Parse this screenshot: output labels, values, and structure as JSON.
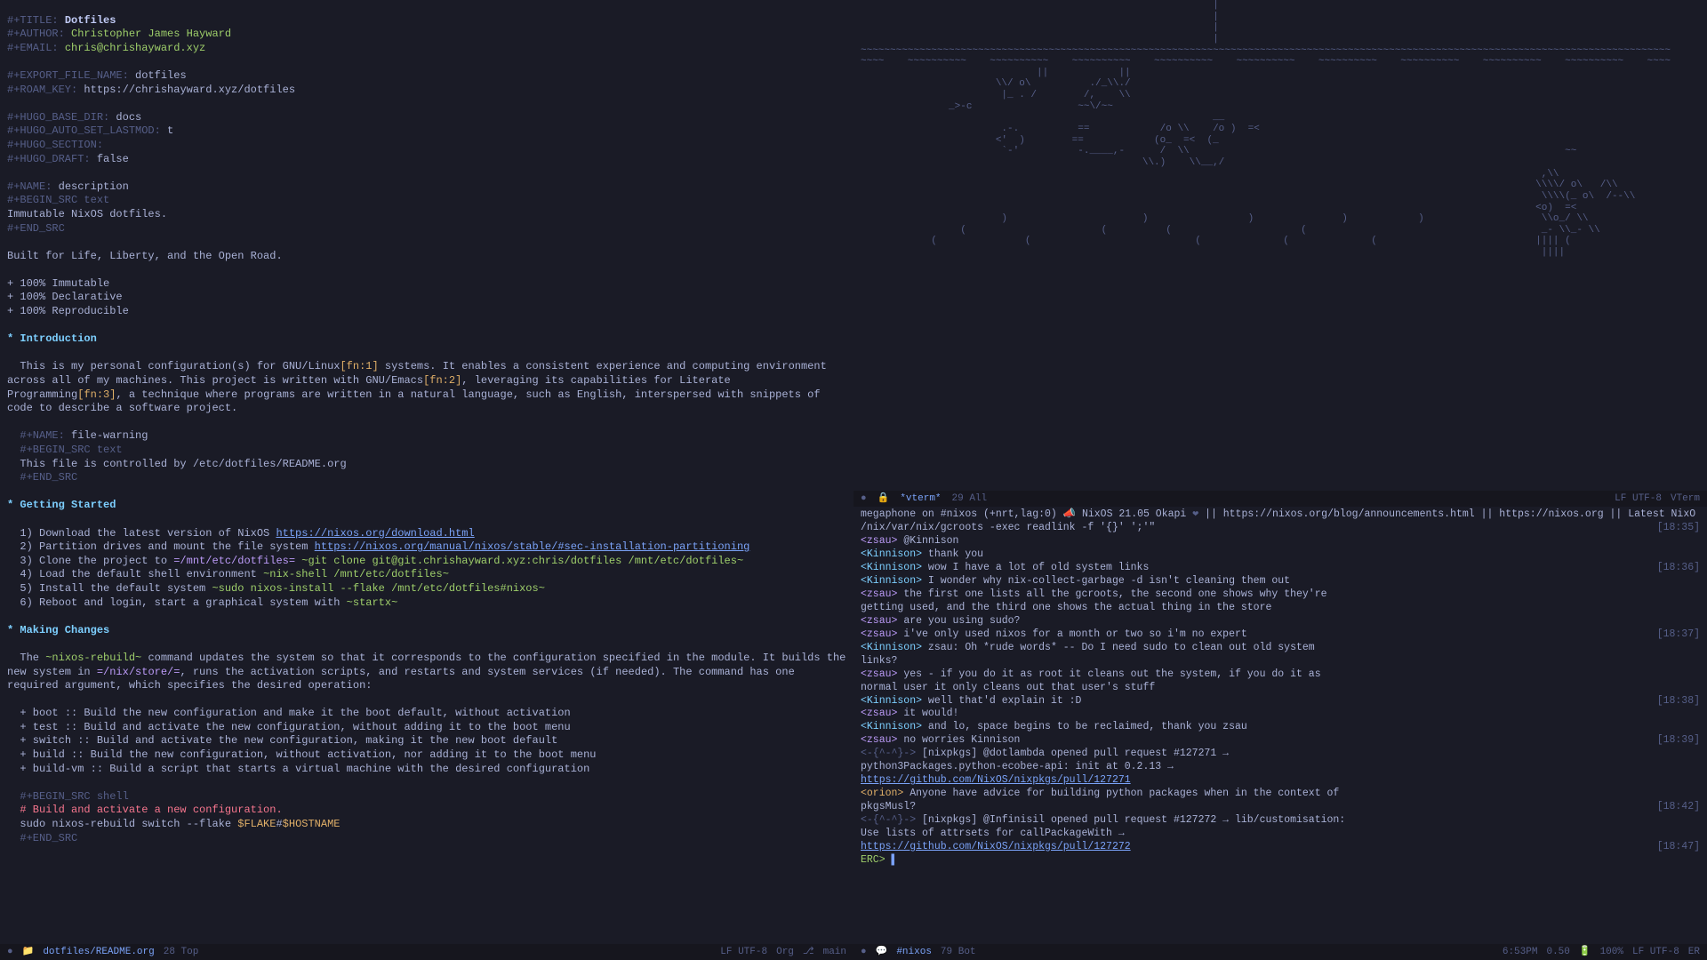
{
  "doc": {
    "title_kw": "#+TITLE:",
    "title": "Dotfiles",
    "author_kw": "#+AUTHOR:",
    "author": "Christopher James Hayward",
    "email_kw": "#+EMAIL:",
    "email": "chris@chrishayward.xyz",
    "export_kw": "#+EXPORT_FILE_NAME:",
    "export": "dotfiles",
    "roam_kw": "#+ROAM_KEY:",
    "roam": "https://chrishayward.xyz/dotfiles",
    "hugo_base_kw": "#+HUGO_BASE_DIR:",
    "hugo_base": "docs",
    "hugo_lastmod_kw": "#+HUGO_AUTO_SET_LASTMOD:",
    "hugo_lastmod": "t",
    "hugo_section_kw": "#+HUGO_SECTION:",
    "hugo_draft_kw": "#+HUGO_DRAFT:",
    "hugo_draft": "false",
    "name_desc_kw": "#+NAME:",
    "name_desc": "description",
    "begin_src_text": "#+BEGIN_SRC text",
    "desc_body": "Immutable NixOS dotfiles.",
    "end_src": "#+END_SRC",
    "tagline": "Built for Life, Liberty, and the Open Road.",
    "bullets": [
      "+ 100% Immutable",
      "+ 100% Declarative",
      "+ 100% Reproducible"
    ],
    "h_intro": "* Introduction",
    "intro_p1a": "This is my personal configuration(s) for GNU/Linux",
    "fn1": "[fn:1]",
    "intro_p1b": " systems. It enables a consistent experience and computing environment across all of my machines. This project is written with GNU/Emacs",
    "fn2": "[fn:2]",
    "intro_p1c": ", leveraging its capabilities for Literate Programming",
    "fn3": "[fn:3]",
    "intro_p1d": ", a technique where programs are written in a natural language, such as English, interspersed with snippets of code to describe a software project.",
    "name_warn": "file-warning",
    "warn_body": "This file is controlled by /etc/dotfiles/README.org",
    "h_getting": "* Getting Started",
    "step1a": "1) Download the latest version of NixOS ",
    "step1_link": "https://nixos.org/download.html",
    "step2a": "2) Partition drives and mount the file system ",
    "step2_link": "https://nixos.org/manual/nixos/stable/#sec-installation-partitioning",
    "step3a": "3) Clone the project to ",
    "step3_path": "=/mnt/etc/dotfiles=",
    "step3_cmd": " ~git clone git@git.chrishayward.xyz:chris/dotfiles /mnt/etc/dotfiles~",
    "step4a": "4) Load the default shell environment ",
    "step4_cmd": "~nix-shell /mnt/etc/dotfiles~",
    "step5a": "5) Install the default system ",
    "step5_cmd": "~sudo nixos-install --flake /mnt/etc/dotfiles#nixos~",
    "step6a": "6) Reboot and login, start a graphical system with ",
    "step6_cmd": "~startx~",
    "h_making": "* Making Changes",
    "mc_p1a": "The ",
    "mc_cmd1": "~nixos-rebuild~",
    "mc_p1b": " command updates the system so that it corresponds to the configuration specified in the module. It builds the new system in ",
    "mc_path": "=/nix/store/=",
    "mc_p1c": ", runs the activation scripts, and restarts and system services (if needed). The command has one required argument, which specifies the desired operation:",
    "ops": [
      "+ boot :: Build the new configuration and make it the boot default, without activation",
      "+ test :: Build and activate the new configuration, without adding it to the boot menu",
      "+ switch :: Build and activate the new configuration, making it the new boot default",
      "+ build :: Build the new configuration, without activation, nor adding it to the boot menu",
      "+ build-vm :: Build a script that starts a virtual machine with the desired configuration"
    ],
    "begin_shell": "#+BEGIN_SRC shell",
    "shell_comment": "# Build and activate a new configuration.",
    "shell_cmd_a": "sudo nixos-rebuild switch --flake ",
    "shell_var1": "$FLAKE",
    "shell_hash": "#",
    "shell_var2": "$HOSTNAME"
  },
  "vterm": {
    "art": "                                                            |\n                                                            |\n                                                            |\n                                                            |\n~~~~~~~~~~~~~~~~~~~~~~~~~~~~~~~~~~~~~~~~~~~~~~~~~~~~~~~~~~~~~~~~~~~~~~~~~~~~~~~~~~~~~~~~~~~~~~~~~~~~~~~~~~~~~~~~~~~~~~~~~~~~~~~~~~~~~~~~~~\n~~~~    ~~~~~~~~~~    ~~~~~~~~~~    ~~~~~~~~~~    ~~~~~~~~~~    ~~~~~~~~~~    ~~~~~~~~~~    ~~~~~~~~~~    ~~~~~~~~~~    ~~~~~~~~~~    ~~~~\n                              ||            ||\n                       \\\\/ o\\          ./_\\\\./\n                        |_ . /        /,    \\\\\n               _>-c                  ~~\\/~~\n                                                            __\n                        .-.          ==            /o \\\\    /o )  =<\n                       <'  )        ==            (o_  =<  (_\n                        `-'          -.____,-      /  \\\\                                                                ~~\n                                                \\\\.)    \\\\__,/\n                                                                                                                    ,\\\\\n                                                                                                                   \\\\\\\\/ o\\   /\\\\\n                                                                                                                    \\\\\\\\(_ o\\  /--\\\\\n                                                                                                                   <o)  =<\n                        )                       )                 )               )            )                    \\\\o_/ \\\\\n                 (                       (          (                      (                                        _- \\\\_- \\\\\n            (               (                            (              (              (                           |||| (\n                                                                                                                    ||||\n",
    "modeline": {
      "buffer": "*vterm*",
      "pos": "29 All",
      "enc": "LF UTF-8",
      "mode": "VTerm"
    }
  },
  "irc": {
    "topic_a": "megaphone on #nixos (+nrt,lag:0) ",
    "topic_b": " NixOS 21.05 Okapi ",
    "topic_c": " || https://nixos.org/blog/announcements.html || https://nixos.org || Latest NixO",
    "topic2": "                /nix/var/nix/gcroots -exec readlink -f '{}' ';'\"",
    "lines": [
      {
        "nick": "zsau",
        "cls": "nick",
        "text": " @Kinnison",
        "ts": ""
      },
      {
        "nick": "Kinnison",
        "cls": "nick2",
        "text": " thank you",
        "ts": ""
      },
      {
        "nick": "Kinnison",
        "cls": "nick2",
        "text": " wow I have a lot of old system links",
        "ts": "[18:36]"
      },
      {
        "nick": "Kinnison",
        "cls": "nick2",
        "text": " I wonder why nix-collect-garbage -d isn't cleaning them out",
        "ts": ""
      },
      {
        "nick": "zsau",
        "cls": "nick",
        "text": " the first one lists all the gcroots, the second one shows why they're",
        "ts": ""
      },
      {
        "nick": "",
        "cls": "",
        "text": "        getting used, and the third one shows the actual thing in the store",
        "ts": ""
      },
      {
        "nick": "zsau",
        "cls": "nick",
        "text": " are you using sudo?",
        "ts": ""
      },
      {
        "nick": "zsau",
        "cls": "nick",
        "text": " i've only used nixos for a month or two so i'm no expert",
        "ts": "[18:37]"
      },
      {
        "nick": "Kinnison",
        "cls": "nick2",
        "text": " zsau: Oh *rude words* -- Do I need sudo to clean out old system",
        "ts": ""
      },
      {
        "nick": "",
        "cls": "",
        "text": "           links?",
        "ts": ""
      },
      {
        "nick": "zsau",
        "cls": "nick",
        "text": " yes - if you do it as root it cleans out the system, if you do it as",
        "ts": ""
      },
      {
        "nick": "",
        "cls": "",
        "text": "        normal user it only cleans out that user's stuff",
        "ts": ""
      },
      {
        "nick": "Kinnison",
        "cls": "nick2",
        "text": " well that'd explain it :D",
        "ts": "[18:38]"
      },
      {
        "nick": "zsau",
        "cls": "nick",
        "text": " it would!",
        "ts": ""
      },
      {
        "nick": "Kinnison",
        "cls": "nick2",
        "text": " and lo, space begins to be reclaimed, thank you zsau",
        "ts": ""
      },
      {
        "nick": "zsau",
        "cls": "nick",
        "text": " no worries Kinnison",
        "ts": "[18:39]"
      },
      {
        "nick": "-{^-^}-",
        "cls": "bot",
        "text": " [nixpkgs] @dotlambda opened pull request #127271 →",
        "ts": ""
      },
      {
        "nick": "",
        "cls": "",
        "text": "          python3Packages.python-ecobee-api: init at 0.2.13 →",
        "ts": ""
      },
      {
        "nick": "",
        "cls": "link",
        "text": "          https://github.com/NixOS/nixpkgs/pull/127271",
        "ts": ""
      },
      {
        "nick": "orion",
        "cls": "nick3",
        "text": " Anyone have advice for building python packages when in the context of",
        "ts": ""
      },
      {
        "nick": "",
        "cls": "",
        "text": "         pkgsMusl?",
        "ts": "[18:42]"
      },
      {
        "nick": "-{^-^}-",
        "cls": "bot",
        "text": " [nixpkgs] @Infinisil opened pull request #127272 → lib/customisation:",
        "ts": ""
      },
      {
        "nick": "",
        "cls": "",
        "text": "          Use lists of attrsets for callPackageWith →",
        "ts": ""
      },
      {
        "nick": "",
        "cls": "link",
        "text": "          https://github.com/NixOS/nixpkgs/pull/127272",
        "ts": "[18:47]"
      }
    ],
    "prompt": "ERC> ",
    "ts_first": "[18:35]"
  },
  "modeline": {
    "left": {
      "file": "dotfiles/README.org",
      "pos": "28 Top",
      "enc": "LF UTF-8",
      "mode": "Org",
      "branch": "main"
    },
    "right": {
      "buffer": "#nixos",
      "pos": "79 Bot",
      "time": "6:53PM",
      "load": "0.50",
      "batt": "100%",
      "enc": "LF UTF-8",
      "mode": "ER"
    }
  }
}
